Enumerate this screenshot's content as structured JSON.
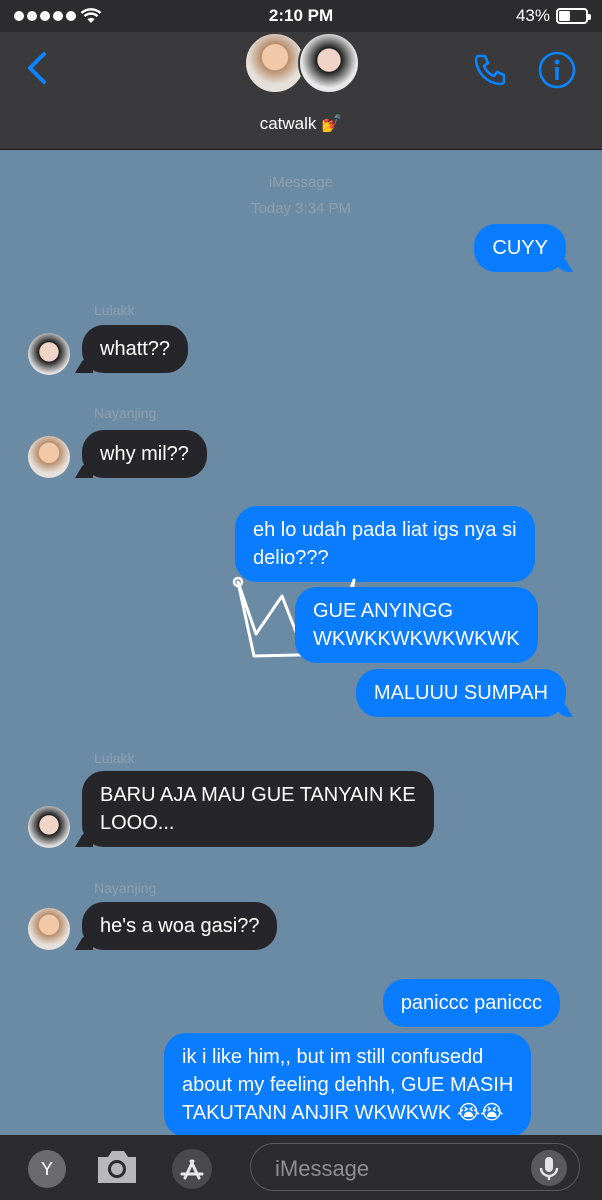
{
  "status_bar": {
    "time": "2:10 PM",
    "battery": "43%",
    "battery_level": 0.43
  },
  "header": {
    "group_name": "catwalk 💅"
  },
  "chat": {
    "service": "iMessage",
    "timestamp": "Today 3:34 PM",
    "messages": [
      {
        "text": "CUYY"
      },
      {
        "sender": "Lulakk",
        "text": "whatt??"
      },
      {
        "sender": "Nayanjing",
        "text": "why mil??"
      },
      {
        "text": "eh lo udah pada liat igs nya si",
        "text2": "delio???"
      },
      {
        "text": "GUE ANYINGG",
        "text2": "WKWKKWKWKWKWK"
      },
      {
        "text": "MALUUU SUMPAH"
      },
      {
        "sender": "Lulakk",
        "text": "BARU AJA MAU GUE TANYAIN KE",
        "text2": "LOOO..."
      },
      {
        "sender": "Nayanjing",
        "text": "he's a woa gasi??"
      },
      {
        "text": "paniccc paniccc"
      },
      {
        "text": "ik i like him,, but im still confusedd",
        "text2": "about my feeling dehhh, GUE MASIH",
        "text3": "TAKUTANN ANJIR WKWKWK 😭😭"
      }
    ]
  },
  "input_bar": {
    "y_label": "Y",
    "placeholder": "iMessage"
  },
  "colors": {
    "outgoing": "#0a7cff",
    "incoming": "#26252a",
    "background": "#6b8aa3",
    "accent": "#0a84ff"
  }
}
